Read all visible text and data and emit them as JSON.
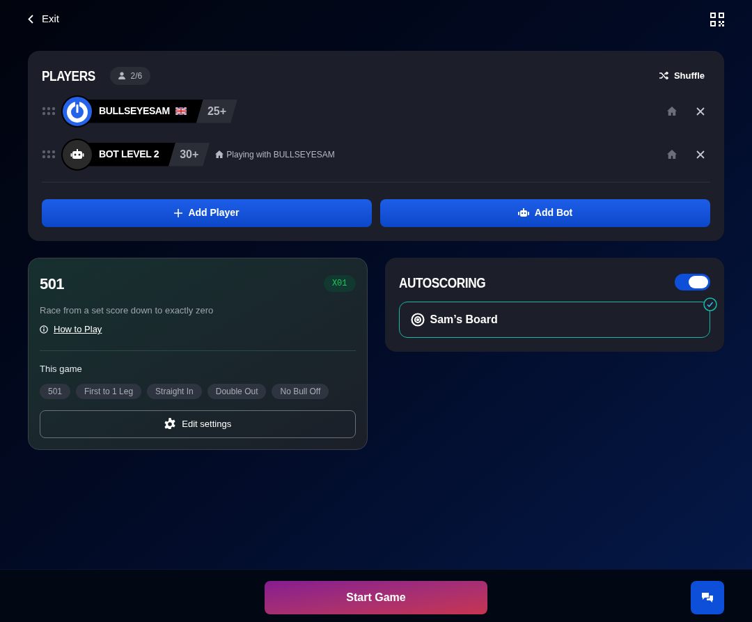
{
  "header": {
    "exit": "Exit"
  },
  "players": {
    "title": "PLAYERS",
    "count": "2/6",
    "shuffle": "Shuffle",
    "list": [
      {
        "kind": "human",
        "name": "BULLSEYESAM",
        "flag": true,
        "rating": "25+"
      },
      {
        "kind": "bot",
        "name": "BOT LEVEL 2",
        "flag": false,
        "rating": "30+",
        "note": "Playing with BULLSEYESAM"
      }
    ],
    "add_player": "Add Player",
    "add_bot": "Add Bot"
  },
  "game": {
    "title": "501",
    "badge": "X01",
    "description": "Race from a set score down to exactly zero",
    "how_to_play": "How to Play",
    "section": "This game",
    "tags": [
      "501",
      "First to 1 Leg",
      "Straight In",
      "Double Out",
      "No Bull Off"
    ],
    "edit": "Edit settings"
  },
  "autoscoring": {
    "title": "AUTOSCORING",
    "on": true,
    "boards": [
      {
        "name": "Sam’s Board",
        "selected": true
      }
    ]
  },
  "footer": {
    "start": "Start Game"
  }
}
